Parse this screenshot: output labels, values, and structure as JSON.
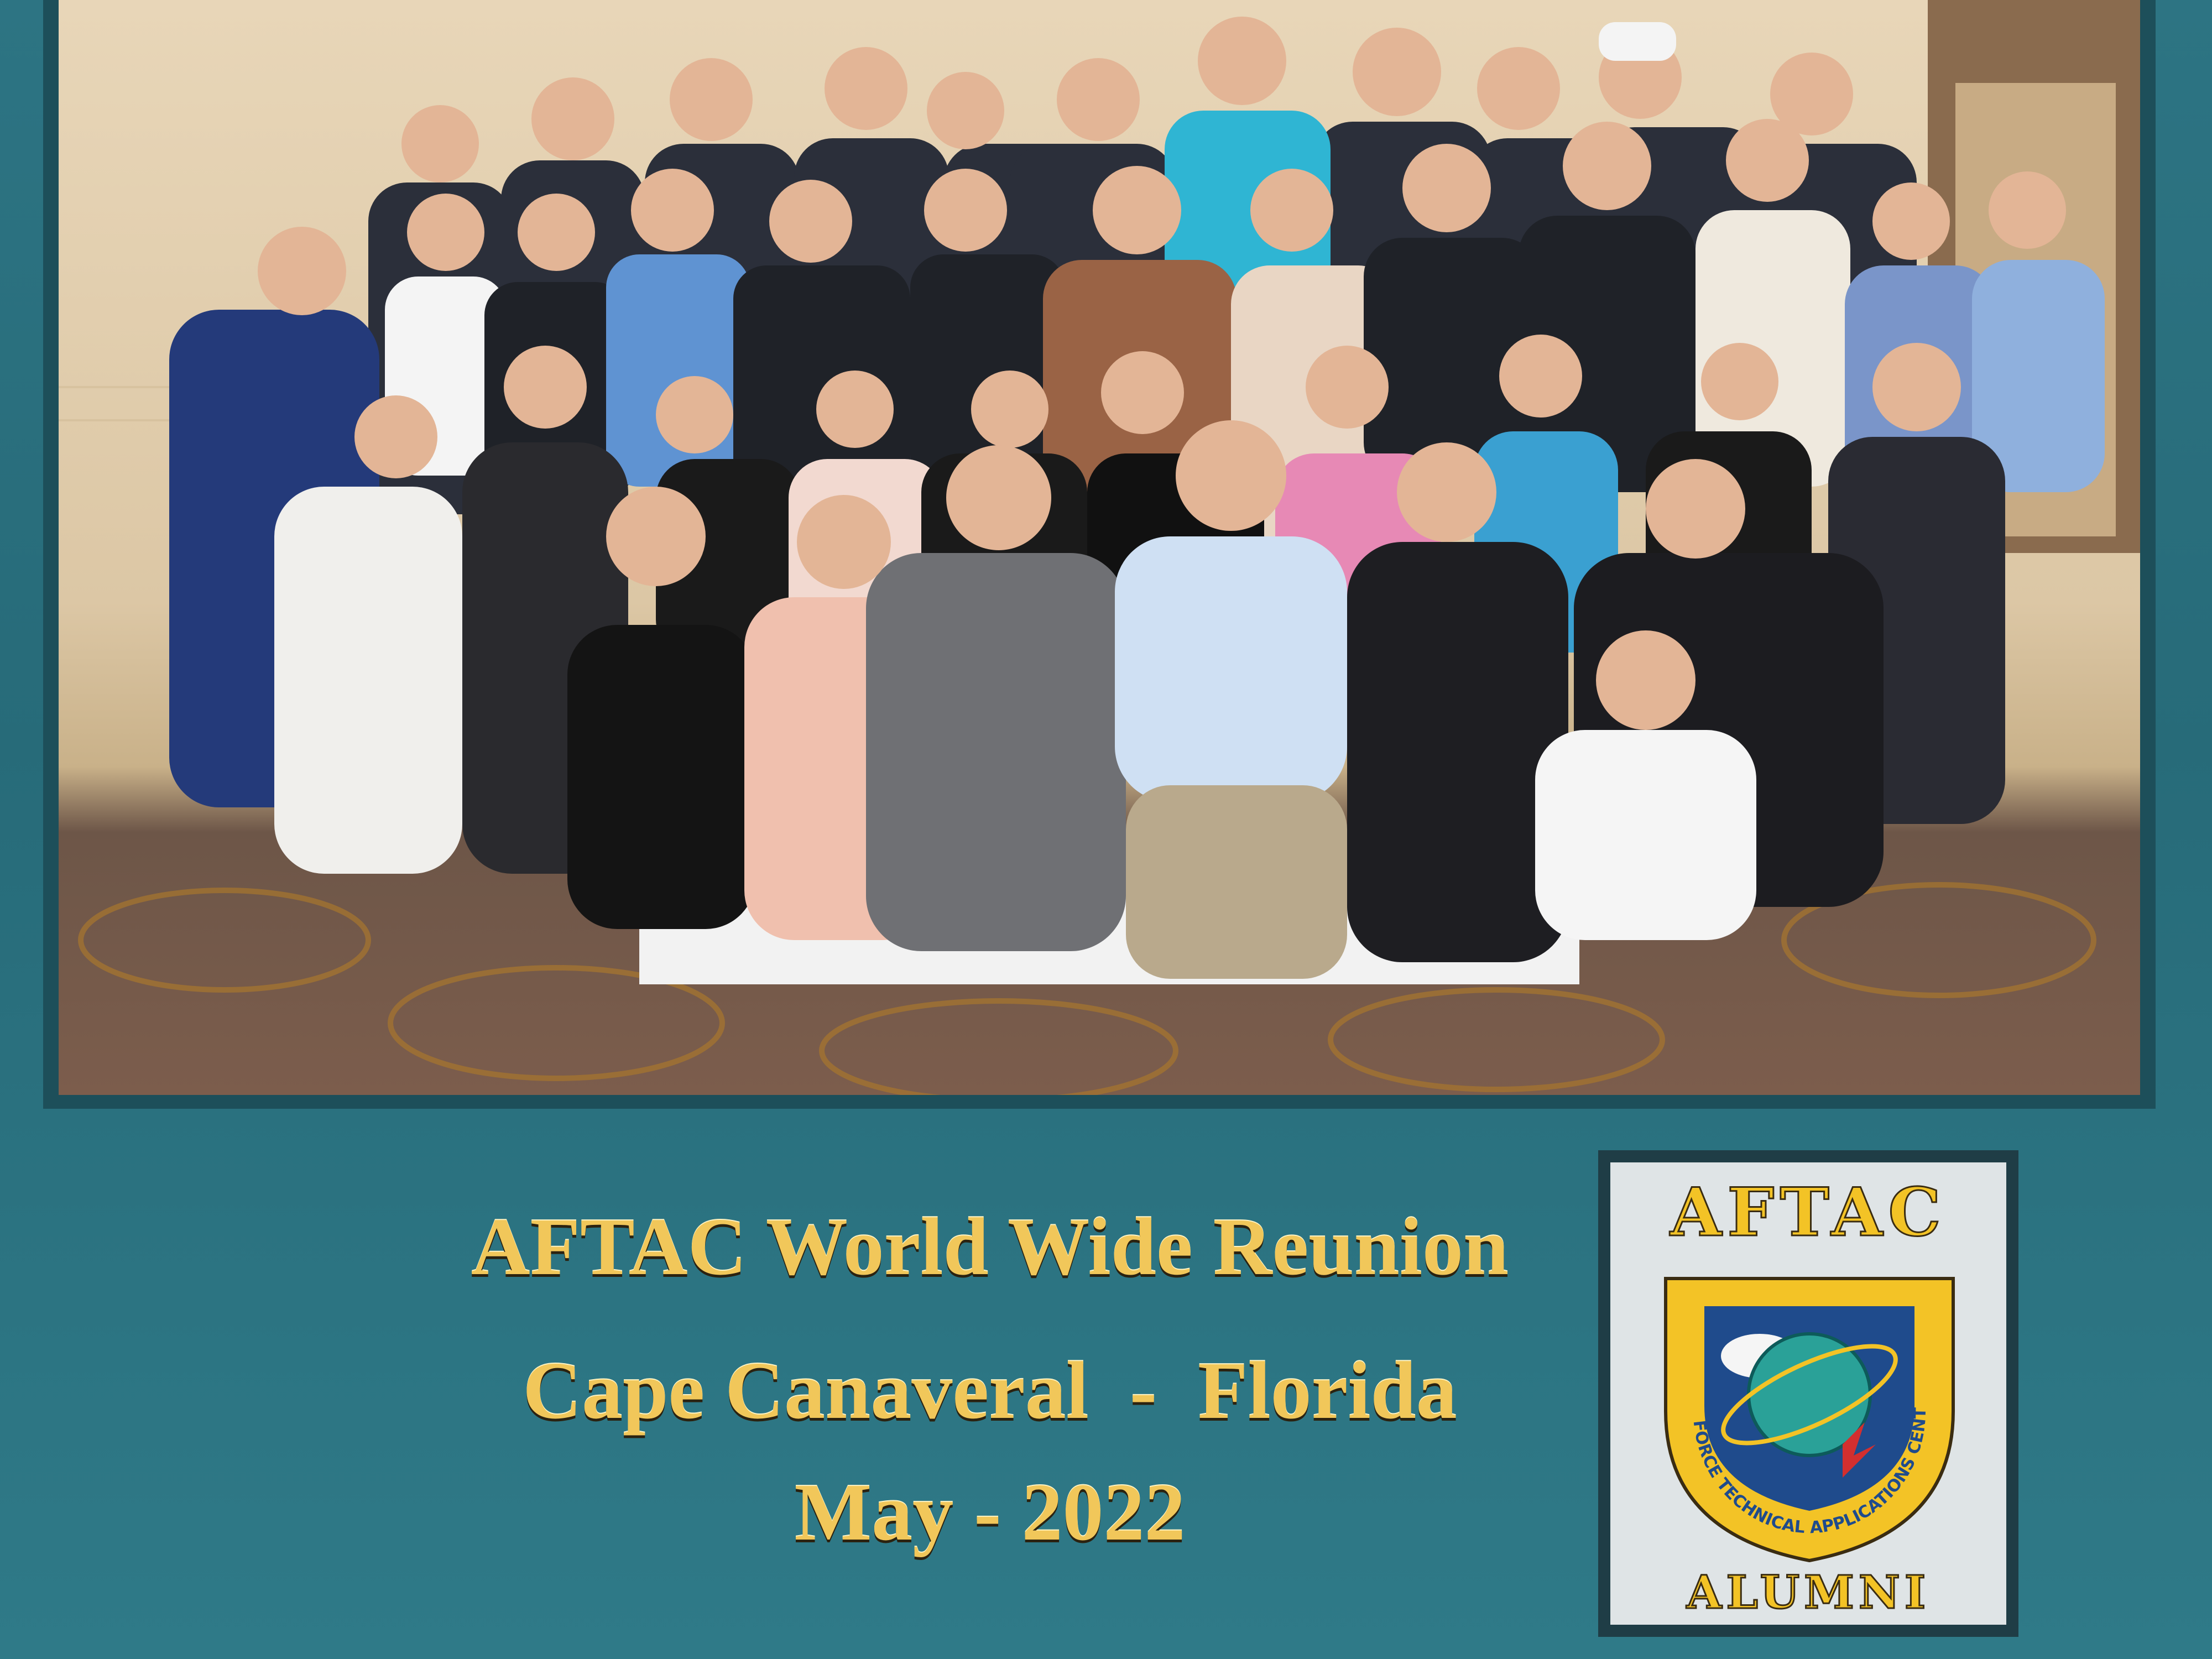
{
  "caption": {
    "line1": "AFTAC World Wide Reunion",
    "line2": "Cape Canaveral  -  Florida",
    "line3": "May - 2022"
  },
  "patch": {
    "top_text": "AFTAC",
    "ring_text": "AIR FORCE TECHNICAL APPLICATIONS CENTER",
    "bottom_text": "ALUMNI"
  },
  "colors": {
    "mat": "#2d7483",
    "caption_gold": "#f1c75a",
    "patch_yellow": "#f3c326",
    "patch_blue": "#1f4b8c"
  }
}
